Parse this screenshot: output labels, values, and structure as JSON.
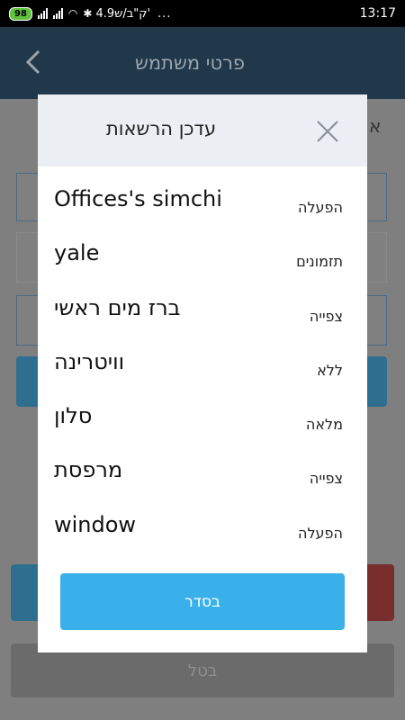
{
  "status_bar": {
    "battery": "98",
    "network_text": "4.9ק\"ב/ש'",
    "dots": "...",
    "time": "13:17"
  },
  "app_header": {
    "title": "פרטי משתמש",
    "back_icon": "chevron-left-icon"
  },
  "background": {
    "side_text": "א",
    "cancel_label": "בטל"
  },
  "dialog": {
    "title": "עדכן הרשאות",
    "close_icon": "close-icon",
    "ok_label": "בסדר",
    "rows": [
      {
        "name": "Offices's simchi",
        "permission": "הפעלה"
      },
      {
        "name": "yale",
        "permission": "תזמונים"
      },
      {
        "name": "ברז מים ראשי",
        "permission": "צפייה"
      },
      {
        "name": "וויטרינה",
        "permission": "ללא"
      },
      {
        "name": "סלון",
        "permission": "מלאה"
      },
      {
        "name": "מרפסת",
        "permission": "צפייה"
      },
      {
        "name": "window",
        "permission": "הפעלה"
      }
    ]
  }
}
